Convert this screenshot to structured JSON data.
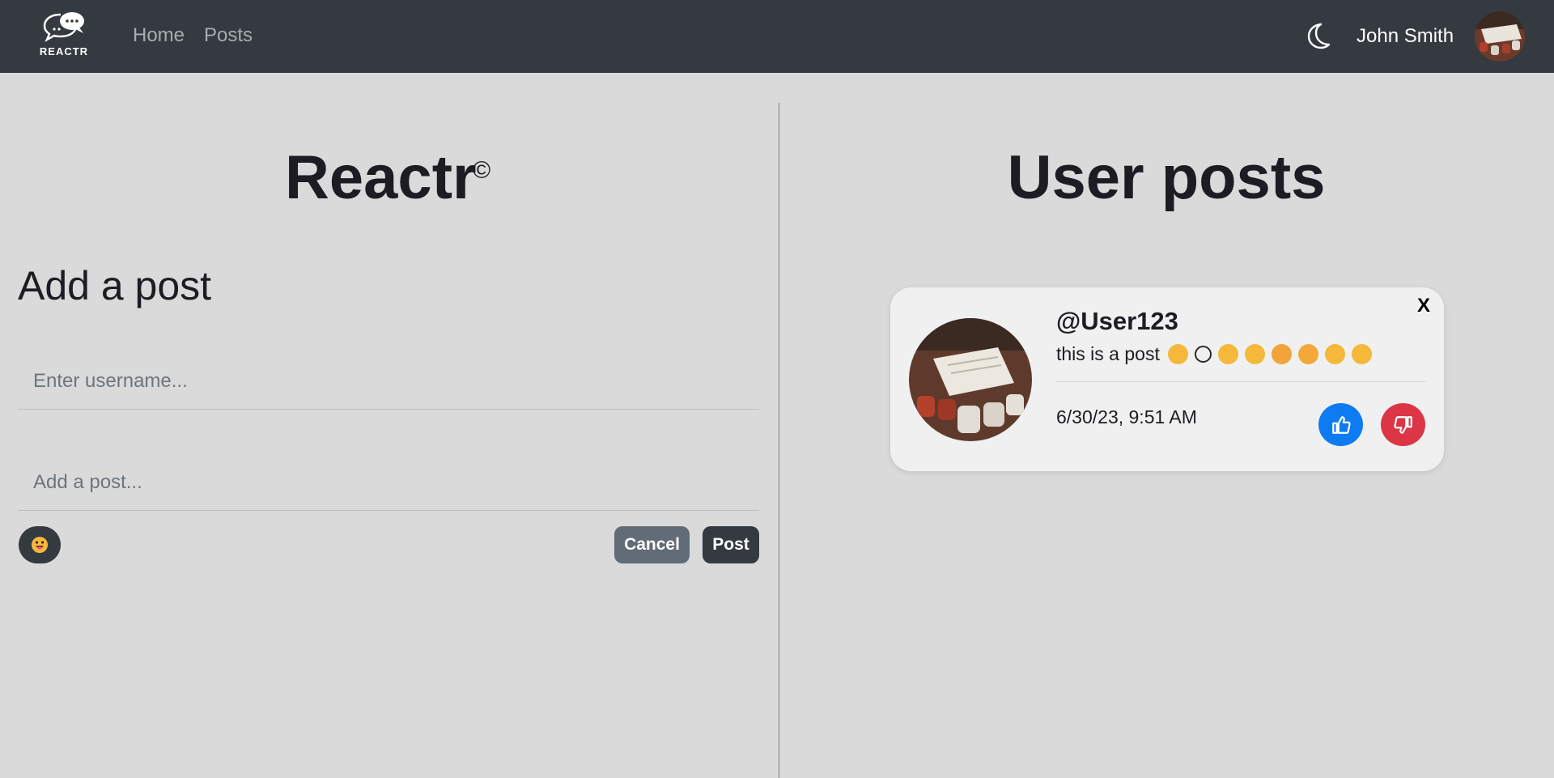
{
  "navbar": {
    "brand_text": "REACTR",
    "links": [
      "Home",
      "Posts"
    ],
    "user_name": "John Smith",
    "theme_icon": "moon-icon"
  },
  "left": {
    "app_title": "Reactr",
    "copyright_symbol": "©",
    "add_post_heading": "Add a post",
    "username_placeholder": "Enter username...",
    "post_placeholder": "Add a post...",
    "emoji_icon": "emoji-face-icon",
    "cancel_label": "Cancel",
    "post_label": "Post"
  },
  "right": {
    "title": "User posts",
    "posts": [
      {
        "username": "@User123",
        "text": "this is a post",
        "emoji_icons": [
          "face-icon",
          "smile-outline-icon",
          "face-icon",
          "face-icon",
          "hearts-face-icon",
          "star-eyes-face-icon",
          "tongue-face-icon",
          "face-icon"
        ],
        "date": "6/30/23, 9:51 AM",
        "close_label": "X",
        "like_icon": "thumbs-up-icon",
        "dislike_icon": "thumbs-down-icon"
      }
    ]
  },
  "colors": {
    "navbar": "#343a40",
    "page_bg": "#dadada",
    "like": "#0d7cf2",
    "dislike": "#dc3545",
    "cancel": "#626c76"
  }
}
